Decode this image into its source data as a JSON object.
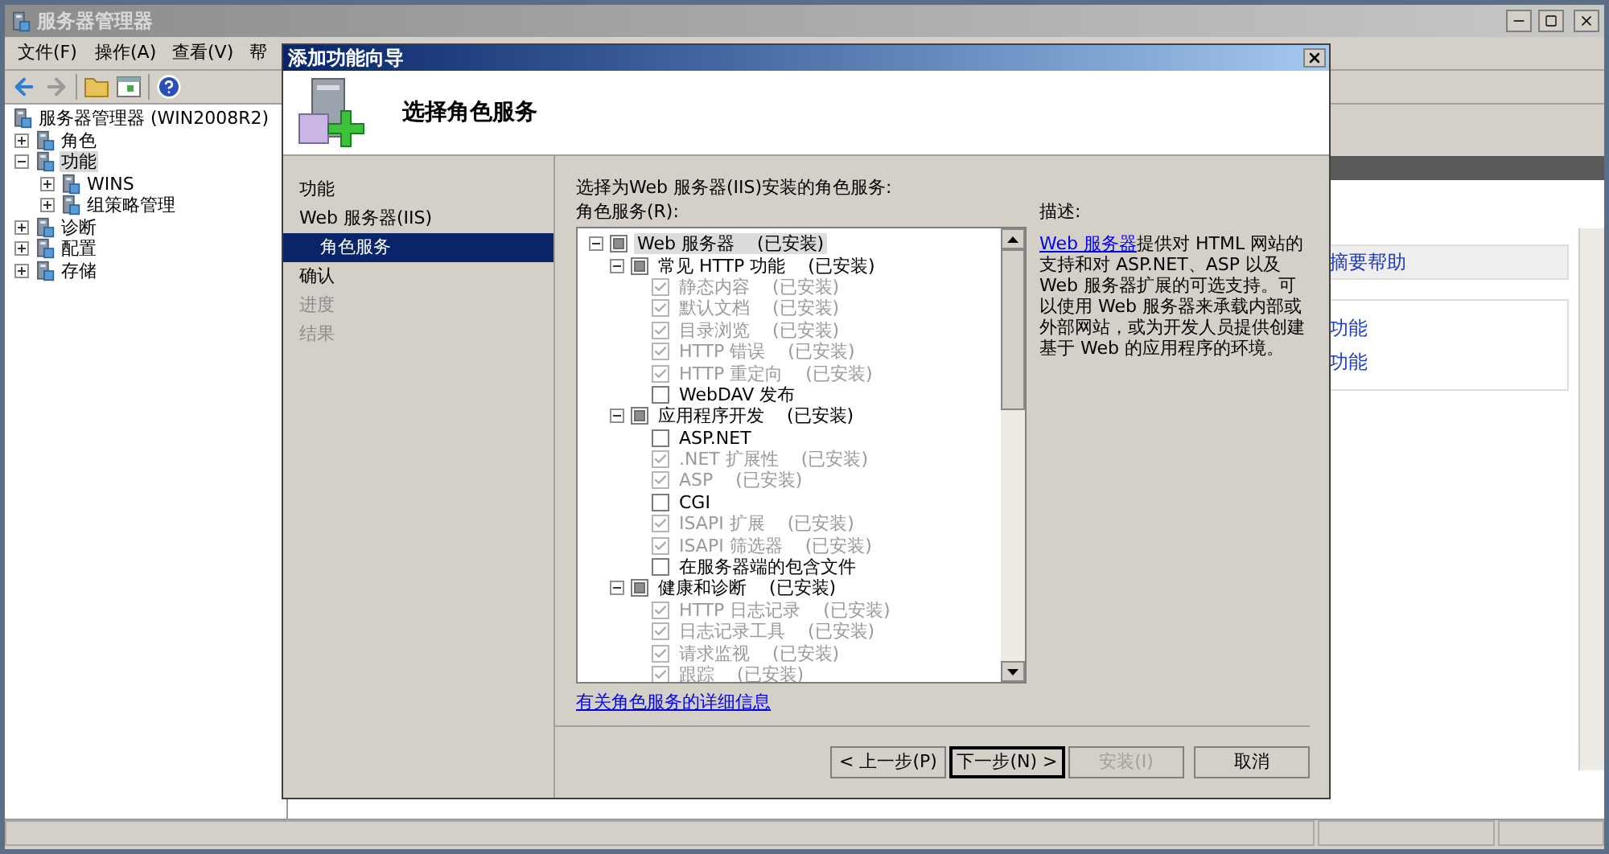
{
  "main_window": {
    "title": "服务器管理器",
    "menu": [
      "文件(F)",
      "操作(A)",
      "查看(V)",
      "帮"
    ],
    "tree": [
      {
        "label": "服务器管理器 (WIN2008R2)",
        "selected": false,
        "children": [
          {
            "label": "角色",
            "expanded": false,
            "selected": false
          },
          {
            "label": "功能",
            "expanded": true,
            "selected": true,
            "children": [
              {
                "label": "WINS",
                "expanded": false,
                "selected": false
              },
              {
                "label": "组策略管理",
                "expanded": false,
                "selected": false
              }
            ]
          },
          {
            "label": "诊断",
            "expanded": false,
            "selected": false
          },
          {
            "label": "配置",
            "expanded": false,
            "selected": false
          },
          {
            "label": "存储",
            "expanded": false,
            "selected": false
          }
        ]
      }
    ],
    "right_pane": {
      "header": "摘要帮助",
      "links": [
        "功能",
        "功能"
      ]
    }
  },
  "dialog": {
    "title": "添加功能向导",
    "heading": "选择角色服务",
    "steps": [
      {
        "label": "功能",
        "selected": false,
        "disabled": false
      },
      {
        "label": "Web 服务器(IIS)",
        "selected": false,
        "disabled": false,
        "children": [
          {
            "label": "角色服务",
            "selected": true,
            "disabled": false
          }
        ]
      },
      {
        "label": "确认",
        "selected": false,
        "disabled": false
      },
      {
        "label": "进度",
        "selected": false,
        "disabled": true
      },
      {
        "label": "结果",
        "selected": false,
        "disabled": true
      }
    ],
    "prompt": "选择为Web 服务器(IIS)安装的角色服务:",
    "list_label": "角色服务(R):",
    "role_services": [
      {
        "label": "Web 服务器",
        "status": "(已安装)",
        "indeterminate": true,
        "disabled": false,
        "selected": true,
        "expanded": true,
        "children": [
          {
            "label": "常见 HTTP 功能",
            "status": "(已安装)",
            "indeterminate": true,
            "disabled": false,
            "selected": false,
            "expanded": true,
            "children": [
              {
                "label": "静态内容",
                "status": "(已安装)",
                "checked": true,
                "disabled": true,
                "selected": false
              },
              {
                "label": "默认文档",
                "status": "(已安装)",
                "checked": true,
                "disabled": true,
                "selected": false
              },
              {
                "label": "目录浏览",
                "status": "(已安装)",
                "checked": true,
                "disabled": true,
                "selected": false
              },
              {
                "label": "HTTP 错误",
                "status": "(已安装)",
                "checked": true,
                "disabled": true,
                "selected": false
              },
              {
                "label": "HTTP 重定向",
                "status": "(已安装)",
                "checked": true,
                "disabled": true,
                "selected": false
              },
              {
                "label": "WebDAV 发布",
                "checked": false,
                "disabled": false,
                "selected": false
              }
            ]
          },
          {
            "label": "应用程序开发",
            "status": "(已安装)",
            "indeterminate": true,
            "disabled": false,
            "selected": false,
            "expanded": true,
            "children": [
              {
                "label": "ASP.NET",
                "checked": false,
                "disabled": false,
                "selected": false
              },
              {
                "label": ".NET 扩展性",
                "status": "(已安装)",
                "checked": true,
                "disabled": true,
                "selected": false
              },
              {
                "label": "ASP",
                "status": "(已安装)",
                "checked": true,
                "disabled": true,
                "selected": false
              },
              {
                "label": "CGI",
                "checked": false,
                "disabled": false,
                "selected": false
              },
              {
                "label": "ISAPI 扩展",
                "status": "(已安装)",
                "checked": true,
                "disabled": true,
                "selected": false
              },
              {
                "label": "ISAPI 筛选器",
                "status": "(已安装)",
                "checked": true,
                "disabled": true,
                "selected": false
              },
              {
                "label": "在服务器端的包含文件",
                "checked": false,
                "disabled": false,
                "selected": false
              }
            ]
          },
          {
            "label": "健康和诊断",
            "status": "(已安装)",
            "indeterminate": true,
            "disabled": false,
            "selected": false,
            "expanded": true,
            "children": [
              {
                "label": "HTTP 日志记录",
                "status": "(已安装)",
                "checked": true,
                "disabled": true,
                "selected": false
              },
              {
                "label": "日志记录工具",
                "status": "(已安装)",
                "checked": true,
                "disabled": true,
                "selected": false
              },
              {
                "label": "请求监视",
                "status": "(已安装)",
                "checked": true,
                "disabled": true,
                "selected": false
              },
              {
                "label": "跟踪",
                "status": "(已安装)",
                "checked": true,
                "disabled": true,
                "selected": false
              }
            ]
          }
        ]
      }
    ],
    "description_label": "描述:",
    "description": {
      "link": "Web 服务器",
      "text": "提供对 HTML 网站的支持和对 ASP.NET、ASP 以及 Web 服务器扩展的可选支持。可以使用 Web 服务器来承载内部或外部网站，或为开发人员提供创建基于 Web 的应用程序的环境。"
    },
    "more_info_link": "有关角色服务的详细信息",
    "buttons": [
      {
        "label": "< 上一步(P)",
        "disabled": false,
        "default": false
      },
      {
        "label": "下一步(N) >",
        "disabled": false,
        "default": true
      },
      {
        "label": "安装(I)",
        "disabled": true,
        "default": false
      },
      {
        "label": "取消",
        "disabled": false,
        "default": false
      }
    ]
  }
}
